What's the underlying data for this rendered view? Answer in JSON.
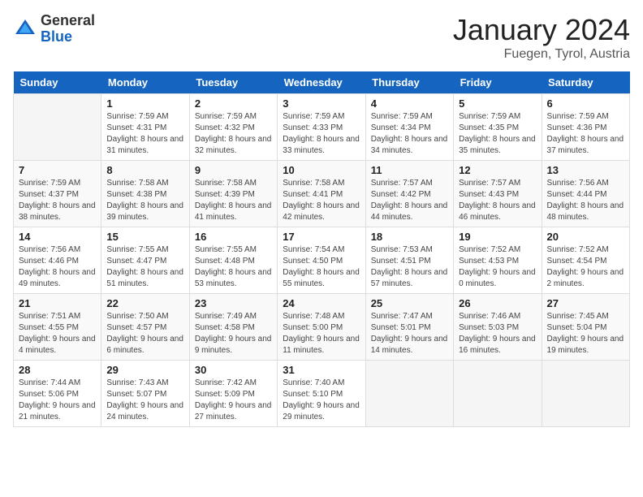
{
  "header": {
    "logo_general": "General",
    "logo_blue": "Blue",
    "title": "January 2024",
    "subtitle": "Fuegen, Tyrol, Austria"
  },
  "weekdays": [
    "Sunday",
    "Monday",
    "Tuesday",
    "Wednesday",
    "Thursday",
    "Friday",
    "Saturday"
  ],
  "weeks": [
    [
      {
        "day": "",
        "sunrise": "",
        "sunset": "",
        "daylight": ""
      },
      {
        "day": "1",
        "sunrise": "Sunrise: 7:59 AM",
        "sunset": "Sunset: 4:31 PM",
        "daylight": "Daylight: 8 hours and 31 minutes."
      },
      {
        "day": "2",
        "sunrise": "Sunrise: 7:59 AM",
        "sunset": "Sunset: 4:32 PM",
        "daylight": "Daylight: 8 hours and 32 minutes."
      },
      {
        "day": "3",
        "sunrise": "Sunrise: 7:59 AM",
        "sunset": "Sunset: 4:33 PM",
        "daylight": "Daylight: 8 hours and 33 minutes."
      },
      {
        "day": "4",
        "sunrise": "Sunrise: 7:59 AM",
        "sunset": "Sunset: 4:34 PM",
        "daylight": "Daylight: 8 hours and 34 minutes."
      },
      {
        "day": "5",
        "sunrise": "Sunrise: 7:59 AM",
        "sunset": "Sunset: 4:35 PM",
        "daylight": "Daylight: 8 hours and 35 minutes."
      },
      {
        "day": "6",
        "sunrise": "Sunrise: 7:59 AM",
        "sunset": "Sunset: 4:36 PM",
        "daylight": "Daylight: 8 hours and 37 minutes."
      }
    ],
    [
      {
        "day": "7",
        "sunrise": "Sunrise: 7:59 AM",
        "sunset": "Sunset: 4:37 PM",
        "daylight": "Daylight: 8 hours and 38 minutes."
      },
      {
        "day": "8",
        "sunrise": "Sunrise: 7:58 AM",
        "sunset": "Sunset: 4:38 PM",
        "daylight": "Daylight: 8 hours and 39 minutes."
      },
      {
        "day": "9",
        "sunrise": "Sunrise: 7:58 AM",
        "sunset": "Sunset: 4:39 PM",
        "daylight": "Daylight: 8 hours and 41 minutes."
      },
      {
        "day": "10",
        "sunrise": "Sunrise: 7:58 AM",
        "sunset": "Sunset: 4:41 PM",
        "daylight": "Daylight: 8 hours and 42 minutes."
      },
      {
        "day": "11",
        "sunrise": "Sunrise: 7:57 AM",
        "sunset": "Sunset: 4:42 PM",
        "daylight": "Daylight: 8 hours and 44 minutes."
      },
      {
        "day": "12",
        "sunrise": "Sunrise: 7:57 AM",
        "sunset": "Sunset: 4:43 PM",
        "daylight": "Daylight: 8 hours and 46 minutes."
      },
      {
        "day": "13",
        "sunrise": "Sunrise: 7:56 AM",
        "sunset": "Sunset: 4:44 PM",
        "daylight": "Daylight: 8 hours and 48 minutes."
      }
    ],
    [
      {
        "day": "14",
        "sunrise": "Sunrise: 7:56 AM",
        "sunset": "Sunset: 4:46 PM",
        "daylight": "Daylight: 8 hours and 49 minutes."
      },
      {
        "day": "15",
        "sunrise": "Sunrise: 7:55 AM",
        "sunset": "Sunset: 4:47 PM",
        "daylight": "Daylight: 8 hours and 51 minutes."
      },
      {
        "day": "16",
        "sunrise": "Sunrise: 7:55 AM",
        "sunset": "Sunset: 4:48 PM",
        "daylight": "Daylight: 8 hours and 53 minutes."
      },
      {
        "day": "17",
        "sunrise": "Sunrise: 7:54 AM",
        "sunset": "Sunset: 4:50 PM",
        "daylight": "Daylight: 8 hours and 55 minutes."
      },
      {
        "day": "18",
        "sunrise": "Sunrise: 7:53 AM",
        "sunset": "Sunset: 4:51 PM",
        "daylight": "Daylight: 8 hours and 57 minutes."
      },
      {
        "day": "19",
        "sunrise": "Sunrise: 7:52 AM",
        "sunset": "Sunset: 4:53 PM",
        "daylight": "Daylight: 9 hours and 0 minutes."
      },
      {
        "day": "20",
        "sunrise": "Sunrise: 7:52 AM",
        "sunset": "Sunset: 4:54 PM",
        "daylight": "Daylight: 9 hours and 2 minutes."
      }
    ],
    [
      {
        "day": "21",
        "sunrise": "Sunrise: 7:51 AM",
        "sunset": "Sunset: 4:55 PM",
        "daylight": "Daylight: 9 hours and 4 minutes."
      },
      {
        "day": "22",
        "sunrise": "Sunrise: 7:50 AM",
        "sunset": "Sunset: 4:57 PM",
        "daylight": "Daylight: 9 hours and 6 minutes."
      },
      {
        "day": "23",
        "sunrise": "Sunrise: 7:49 AM",
        "sunset": "Sunset: 4:58 PM",
        "daylight": "Daylight: 9 hours and 9 minutes."
      },
      {
        "day": "24",
        "sunrise": "Sunrise: 7:48 AM",
        "sunset": "Sunset: 5:00 PM",
        "daylight": "Daylight: 9 hours and 11 minutes."
      },
      {
        "day": "25",
        "sunrise": "Sunrise: 7:47 AM",
        "sunset": "Sunset: 5:01 PM",
        "daylight": "Daylight: 9 hours and 14 minutes."
      },
      {
        "day": "26",
        "sunrise": "Sunrise: 7:46 AM",
        "sunset": "Sunset: 5:03 PM",
        "daylight": "Daylight: 9 hours and 16 minutes."
      },
      {
        "day": "27",
        "sunrise": "Sunrise: 7:45 AM",
        "sunset": "Sunset: 5:04 PM",
        "daylight": "Daylight: 9 hours and 19 minutes."
      }
    ],
    [
      {
        "day": "28",
        "sunrise": "Sunrise: 7:44 AM",
        "sunset": "Sunset: 5:06 PM",
        "daylight": "Daylight: 9 hours and 21 minutes."
      },
      {
        "day": "29",
        "sunrise": "Sunrise: 7:43 AM",
        "sunset": "Sunset: 5:07 PM",
        "daylight": "Daylight: 9 hours and 24 minutes."
      },
      {
        "day": "30",
        "sunrise": "Sunrise: 7:42 AM",
        "sunset": "Sunset: 5:09 PM",
        "daylight": "Daylight: 9 hours and 27 minutes."
      },
      {
        "day": "31",
        "sunrise": "Sunrise: 7:40 AM",
        "sunset": "Sunset: 5:10 PM",
        "daylight": "Daylight: 9 hours and 29 minutes."
      },
      {
        "day": "",
        "sunrise": "",
        "sunset": "",
        "daylight": ""
      },
      {
        "day": "",
        "sunrise": "",
        "sunset": "",
        "daylight": ""
      },
      {
        "day": "",
        "sunrise": "",
        "sunset": "",
        "daylight": ""
      }
    ]
  ]
}
